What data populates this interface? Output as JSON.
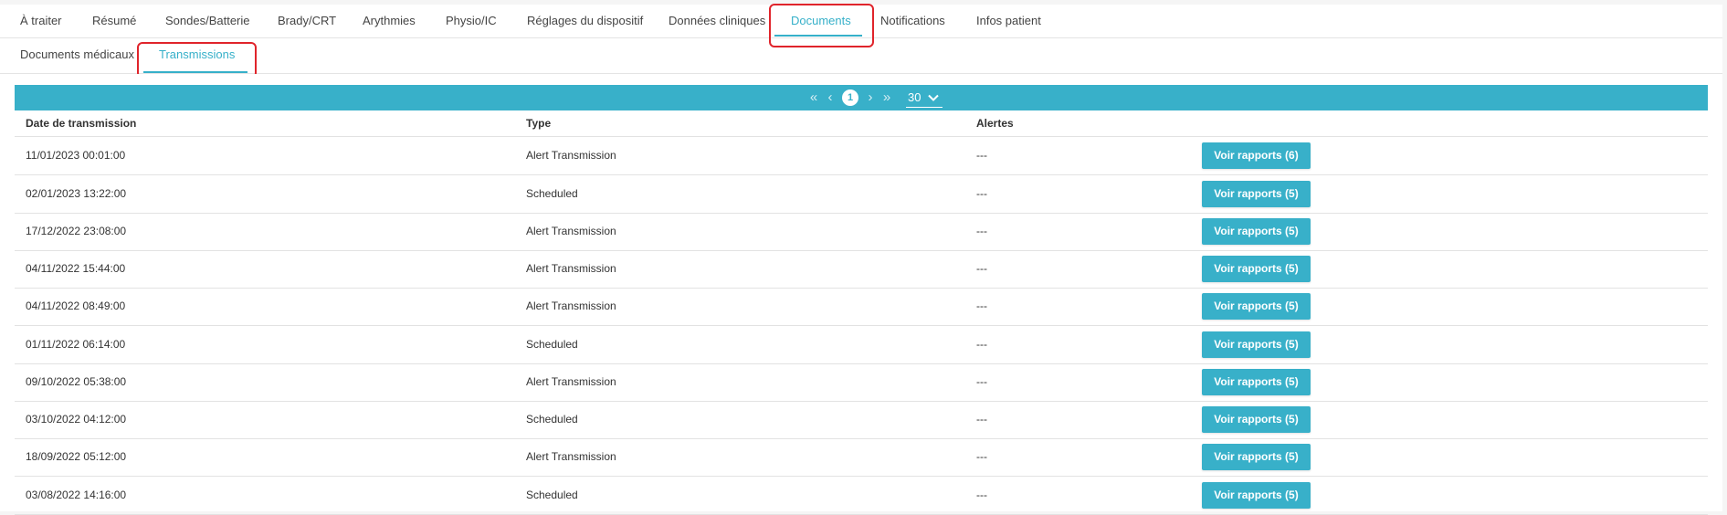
{
  "main_tabs": [
    {
      "label": "À traiter"
    },
    {
      "label": "Résumé"
    },
    {
      "label": "Sondes/Batterie"
    },
    {
      "label": "Brady/CRT"
    },
    {
      "label": "Arythmies"
    },
    {
      "label": "Physio/IC"
    },
    {
      "label": "Réglages du dispositif"
    },
    {
      "label": "Données cliniques"
    },
    {
      "label": "Documents"
    },
    {
      "label": "Notifications"
    },
    {
      "label": "Infos patient"
    }
  ],
  "active_main_tab": "Documents",
  "sub_tabs": [
    {
      "label": "Documents médicaux"
    },
    {
      "label": "Transmissions"
    }
  ],
  "active_sub_tab": "Transmissions",
  "pagination": {
    "first_icon": "double-chevron-left-icon",
    "prev_icon": "chevron-left-icon",
    "next_icon": "chevron-right-icon",
    "last_icon": "double-chevron-right-icon",
    "current_page": "1",
    "page_size": "30"
  },
  "table": {
    "columns": [
      "Date de transmission",
      "Type",
      "Alertes"
    ],
    "rows": [
      {
        "date": "11/01/2023 00:01:00",
        "type": "Alert Transmission",
        "alerts": "---",
        "button": "Voir rapports (6)"
      },
      {
        "date": "02/01/2023 13:22:00",
        "type": "Scheduled",
        "alerts": "---",
        "button": "Voir rapports (5)"
      },
      {
        "date": "17/12/2022 23:08:00",
        "type": "Alert Transmission",
        "alerts": "---",
        "button": "Voir rapports (5)"
      },
      {
        "date": "04/11/2022 15:44:00",
        "type": "Alert Transmission",
        "alerts": "---",
        "button": "Voir rapports (5)"
      },
      {
        "date": "04/11/2022 08:49:00",
        "type": "Alert Transmission",
        "alerts": "---",
        "button": "Voir rapports (5)"
      },
      {
        "date": "01/11/2022 06:14:00",
        "type": "Scheduled",
        "alerts": "---",
        "button": "Voir rapports (5)"
      },
      {
        "date": "09/10/2022 05:38:00",
        "type": "Alert Transmission",
        "alerts": "---",
        "button": "Voir rapports (5)"
      },
      {
        "date": "03/10/2022 04:12:00",
        "type": "Scheduled",
        "alerts": "---",
        "button": "Voir rapports (5)"
      },
      {
        "date": "18/09/2022 05:12:00",
        "type": "Alert Transmission",
        "alerts": "---",
        "button": "Voir rapports (5)"
      },
      {
        "date": "03/08/2022 14:16:00",
        "type": "Scheduled",
        "alerts": "---",
        "button": "Voir rapports (5)"
      }
    ]
  },
  "colors": {
    "accent": "#38b0c9",
    "highlight": "#e0242b",
    "text": "#333333",
    "background": "#ffffff"
  }
}
